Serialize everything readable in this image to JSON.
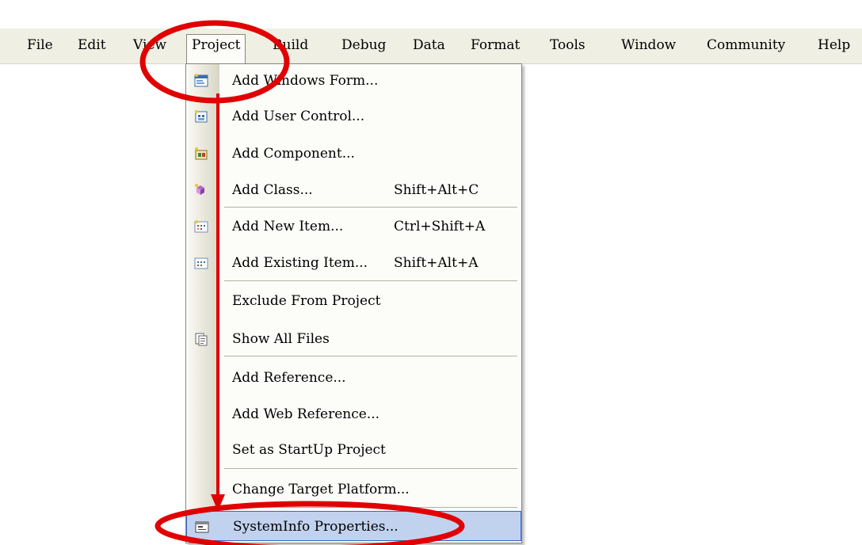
{
  "menubar": {
    "items": [
      {
        "label": "File"
      },
      {
        "label": "Edit"
      },
      {
        "label": "View"
      },
      {
        "label": "Project"
      },
      {
        "label": "Build"
      },
      {
        "label": "Debug"
      },
      {
        "label": "Data"
      },
      {
        "label": "Format"
      },
      {
        "label": "Tools"
      },
      {
        "label": "Window"
      },
      {
        "label": "Community"
      },
      {
        "label": "Help"
      }
    ]
  },
  "project_menu": {
    "items": [
      {
        "label": "Add Windows Form...",
        "shortcut": ""
      },
      {
        "label": "Add User Control...",
        "shortcut": ""
      },
      {
        "label": "Add Component...",
        "shortcut": ""
      },
      {
        "label": "Add Class...",
        "shortcut": "Shift+Alt+C"
      },
      {
        "label": "Add New Item...",
        "shortcut": "Ctrl+Shift+A"
      },
      {
        "label": "Add Existing Item...",
        "shortcut": "Shift+Alt+A"
      },
      {
        "label": "Exclude From Project",
        "shortcut": ""
      },
      {
        "label": "Show All Files",
        "shortcut": ""
      },
      {
        "label": "Add Reference...",
        "shortcut": ""
      },
      {
        "label": "Add Web Reference...",
        "shortcut": ""
      },
      {
        "label": "Set as StartUp Project",
        "shortcut": ""
      },
      {
        "label": "Change Target Platform...",
        "shortcut": ""
      },
      {
        "label": "SystemInfo Properties...",
        "shortcut": ""
      }
    ]
  },
  "colors": {
    "menubar_bg": "#f0efe4",
    "highlight_bg": "#c1d2ee",
    "highlight_border": "#316ac5",
    "annotation_red": "#e00000"
  }
}
